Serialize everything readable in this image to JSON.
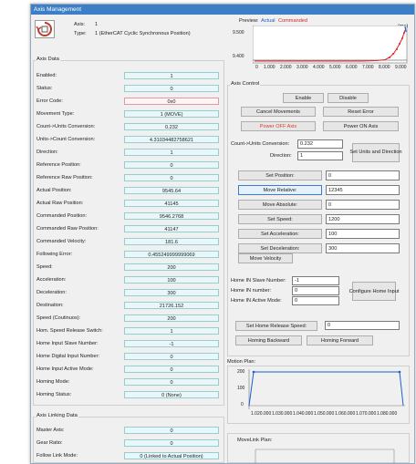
{
  "window": {
    "title": "Axis Management"
  },
  "axis_info": {
    "axis_label": "Axis:",
    "axis_value": "1",
    "type_label": "Type:",
    "type_value": "1 (EtherCAT Cyclic Synchronous Position)"
  },
  "preview": {
    "label": "Preview:",
    "legend_actual": "Actual",
    "legend_commanded": "Commanded",
    "unit": "(ms)",
    "y_ticks": [
      "9.500",
      "9.400"
    ],
    "x_ticks": [
      "0",
      "1.000",
      "2.000",
      "3.000",
      "4.000",
      "5.000",
      "6.000",
      "7.000",
      "8.000",
      "9.000"
    ]
  },
  "axis_data": {
    "title": "Axis Data",
    "rows": [
      {
        "label": "Enabled:",
        "value": "1"
      },
      {
        "label": "Status:",
        "value": "0"
      },
      {
        "label": "Error Code:",
        "value": "0x0"
      },
      {
        "label": "Movement Type:",
        "value": "1 (MOVE)"
      },
      {
        "label": "Count->Units Conversion:",
        "value": "0.232"
      },
      {
        "label": "Units->Count Conversion:",
        "value": "4.31034482758621"
      },
      {
        "label": "Direction:",
        "value": "1"
      },
      {
        "label": "Reference Position:",
        "value": "0"
      },
      {
        "label": "Reference Raw Position:",
        "value": "0"
      },
      {
        "label": "Actual Position:",
        "value": "9545.64"
      },
      {
        "label": "Actual Raw Position:",
        "value": "41145"
      },
      {
        "label": "Commanded Position:",
        "value": "9546.2768"
      },
      {
        "label": "Commanded Raw Position:",
        "value": "41147"
      },
      {
        "label": "Commanded Velocity:",
        "value": "181.6"
      },
      {
        "label": "Following Error:",
        "value": "0.455249999999069"
      },
      {
        "label": "Speed:",
        "value": "200"
      },
      {
        "label": "Acceleration:",
        "value": "100"
      },
      {
        "label": "Deceleration:",
        "value": "300"
      },
      {
        "label": "Destination:",
        "value": "21726.152"
      },
      {
        "label": "Speed (Coutinuos):",
        "value": "200"
      },
      {
        "label": "Hom. Speed Release Switch:",
        "value": "1"
      },
      {
        "label": "Home Input Slave Number:",
        "value": "-1"
      },
      {
        "label": "Home Digital Input Number:",
        "value": "0"
      },
      {
        "label": "Home Input Active Mode:",
        "value": "0"
      },
      {
        "label": "Homing Mode:",
        "value": "0"
      },
      {
        "label": "Homing Status:",
        "value": "0 (None)"
      }
    ]
  },
  "axis_linking": {
    "title": "Axis Linking Data",
    "rows": [
      {
        "label": "Master Axis:",
        "value": "0"
      },
      {
        "label": "Gear Ratio:",
        "value": "0"
      },
      {
        "label": "Follow Link Mode:",
        "value": "0 (Linked to Actual Position)"
      }
    ]
  },
  "axis_control": {
    "title": "Axis Control",
    "enable": "Enable",
    "disable": "Disable",
    "cancel_movements": "Cancel Movements",
    "reset_error": "Reset Error",
    "power_off": "Power OFF Axis",
    "power_on": "Power ON Axis",
    "count_units_label": "Count->Units Conversion:",
    "count_units_value": "0.232",
    "direction_label": "Direction:",
    "direction_value": "1",
    "set_units_direction": "Set Units and Direction",
    "actions": [
      {
        "label": "Set Position:",
        "value": "0"
      },
      {
        "label": "Move Relative:",
        "value": "12345"
      },
      {
        "label": "Move Absolute:",
        "value": "0"
      },
      {
        "label": "Set Speed:",
        "value": "1200"
      },
      {
        "label": "Set Acceleration:",
        "value": "100"
      },
      {
        "label": "Set Deceleration:",
        "value": "300"
      }
    ],
    "move_velocity": "Move Velocity",
    "home_slave_label": "Home IN Slave Number:",
    "home_slave_value": "-1",
    "home_in_label": "Home IN number:",
    "home_in_value": "0",
    "home_mode_label": "Home IN Active Mode:",
    "home_mode_value": "0",
    "configure_home": "Configure Home Input",
    "set_home_speed": "Set Home Release Speed:",
    "home_speed_value": "0",
    "homing_backward": "Homing Backward",
    "homing_forward": "Homing Forward"
  },
  "motion_plan": {
    "title": "Motion Plan:",
    "y_ticks": [
      "200",
      "100",
      "0"
    ],
    "x_ticks": [
      "1.020.000",
      "1.030.000",
      "1.040.000",
      "1.050.000",
      "1.060.000",
      "1.070.000",
      "1.080.000"
    ]
  },
  "movelink_plan": {
    "title": "MoveLink Plan:"
  },
  "colors": {
    "titlebar": "#3d7fc6",
    "actual": "#1a5fd0",
    "commanded": "#e02020",
    "field_bg": "#e8f7f9",
    "power_text": "#e03a2a"
  }
}
